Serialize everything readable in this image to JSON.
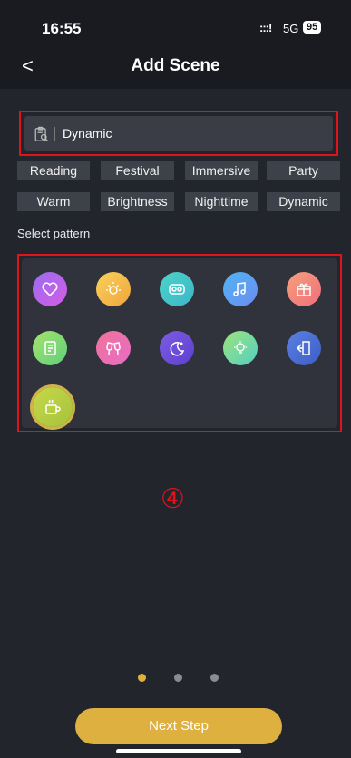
{
  "status": {
    "time": "16:55",
    "signal": ":::!",
    "network": "5G",
    "battery": "95"
  },
  "nav": {
    "back_glyph": "<",
    "title": "Add Scene"
  },
  "search": {
    "value": "Dynamic",
    "icon": "clipboard-search-icon"
  },
  "tags": [
    "Reading",
    "Festival",
    "Immersive",
    "Party",
    "Warm",
    "Brightness",
    "Nighttime",
    "Dynamic"
  ],
  "select_pattern_label": "Select pattern",
  "patterns": [
    {
      "name": "heart-icon",
      "gradient": [
        "#9b6cf0",
        "#d35de6"
      ]
    },
    {
      "name": "sun-icon",
      "gradient": [
        "#f8d15a",
        "#f0a53e"
      ]
    },
    {
      "name": "vr-goggles-icon",
      "gradient": [
        "#4fd2c7",
        "#39b7c9"
      ]
    },
    {
      "name": "music-note-icon",
      "gradient": [
        "#4fb4f5",
        "#6e8cf0"
      ]
    },
    {
      "name": "gift-icon",
      "gradient": [
        "#f6a07c",
        "#ef6f7a"
      ]
    },
    {
      "name": "scroll-icon",
      "gradient": [
        "#a6e36a",
        "#5fcf7e"
      ]
    },
    {
      "name": "cheers-icon",
      "gradient": [
        "#f0739b",
        "#e86cc4"
      ]
    },
    {
      "name": "moon-icon",
      "gradient": [
        "#7c5de0",
        "#5d3fd2"
      ]
    },
    {
      "name": "light-bulb-icon",
      "gradient": [
        "#9de37c",
        "#53d0c1"
      ]
    },
    {
      "name": "door-exit-icon",
      "gradient": [
        "#5b7fe0",
        "#3d5ec8"
      ]
    },
    {
      "name": "coffee-cup-icon",
      "gradient": [
        "#c8d84a",
        "#a5c33b"
      ],
      "selected": true
    }
  ],
  "annotation": "④",
  "pager": {
    "count": 3,
    "active": 0
  },
  "next_button": "Next Step",
  "colors": {
    "accent": "#ddb040",
    "highlight_border": "#e0131b",
    "background": "#22252c"
  }
}
